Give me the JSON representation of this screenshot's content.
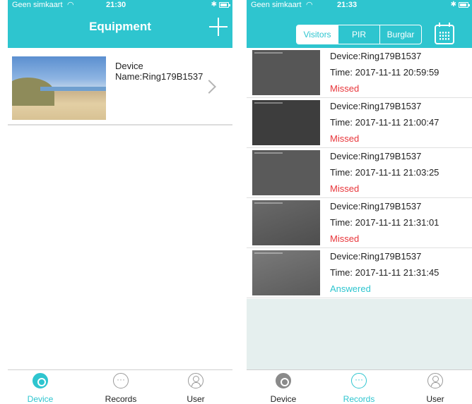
{
  "colors": {
    "accent": "#2ec5cf",
    "missed": "#e8353a",
    "answered": "#2ec5cf"
  },
  "left_screen": {
    "status": {
      "carrier": "Geen simkaart",
      "time": "21:30"
    },
    "header": {
      "title": "Equipment",
      "add_icon": "plus-icon"
    },
    "device": {
      "line1": "Device",
      "line2": "Name:Ring179B1537"
    },
    "tabs": [
      {
        "label": "Device",
        "icon": "device-icon",
        "active": true
      },
      {
        "label": "Records",
        "icon": "chat-icon",
        "active": false
      },
      {
        "label": "User",
        "icon": "user-icon",
        "active": false
      }
    ]
  },
  "right_screen": {
    "status": {
      "carrier": "Geen simkaart",
      "time": "21:33"
    },
    "segments": [
      "Visitors",
      "PIR",
      "Burglar"
    ],
    "active_segment": "Visitors",
    "records": [
      {
        "device": "Device:Ring179B1537",
        "time": "Time: 2017-11-11 20:59:59",
        "status": "Missed"
      },
      {
        "device": "Device:Ring179B1537",
        "time": "Time: 2017-11-11 21:00:47",
        "status": "Missed"
      },
      {
        "device": "Device:Ring179B1537",
        "time": "Time: 2017-11-11 21:03:25",
        "status": "Missed"
      },
      {
        "device": "Device:Ring179B1537",
        "time": "Time: 2017-11-11 21:31:01",
        "status": "Missed"
      },
      {
        "device": "Device:Ring179B1537",
        "time": "Time: 2017-11-11 21:31:45",
        "status": "Answered"
      }
    ],
    "tabs": [
      {
        "label": "Device",
        "icon": "device-icon",
        "active": false
      },
      {
        "label": "Records",
        "icon": "chat-icon",
        "active": true
      },
      {
        "label": "User",
        "icon": "user-icon",
        "active": false
      }
    ]
  }
}
